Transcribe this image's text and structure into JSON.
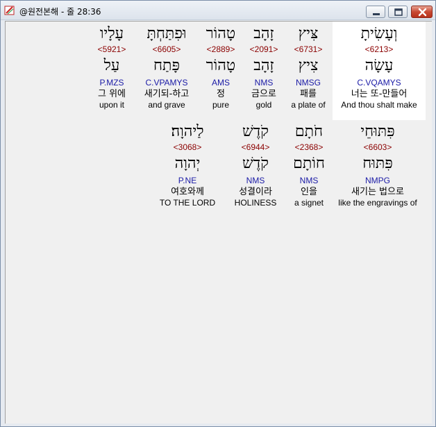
{
  "window": {
    "title": "@원전본해 - 줄 28:36",
    "icon": "bible-app-icon",
    "buttons": [
      "minimize",
      "maximize",
      "close"
    ]
  },
  "row1": [
    {
      "hebrew": "וְעָשִׂיתָ",
      "strong": "<6213>",
      "lemma": "עָשָׂה",
      "morph": "C.VQAMYS",
      "korean": "너는 또-만들어",
      "english": "And thou shalt make",
      "highlighted": true
    },
    {
      "hebrew": "צִּיץ",
      "strong": "<6731>",
      "lemma": "צִיץ",
      "morph": "NMSG",
      "korean": "패를",
      "english": "a plate of"
    },
    {
      "hebrew": "זָהָב",
      "strong": "<2091>",
      "lemma": "זָהָב",
      "morph": "NMS",
      "korean": "금으로",
      "english": "gold"
    },
    {
      "hebrew": "טָהוֹר",
      "strong": "<2889>",
      "lemma": "טָהוֹר",
      "morph": "AMS",
      "korean": "정",
      "english": "pure"
    },
    {
      "hebrew": "וּפִתַּחְתָּ",
      "strong": "<6605>",
      "lemma": "פָּתַח",
      "morph": "C.VPAMYS",
      "korean": "새기되-하고",
      "english": "and grave"
    },
    {
      "hebrew": "עָלָיו",
      "strong": "<5921>",
      "lemma": "עַל",
      "morph": "P.MZS",
      "korean": "그 위에",
      "english": "upon it"
    }
  ],
  "row2": [
    {
      "hebrew": "פִּתּוּחֵי",
      "strong": "<6603>",
      "lemma": "פִּתּוּח",
      "morph": "NMPG",
      "korean": "새기는 법으로",
      "english": "like the engravings of"
    },
    {
      "hebrew": "חֹתָם",
      "strong": "<2368>",
      "lemma": "חוֹתָם",
      "morph": "NMS",
      "korean": "인을",
      "english": "a signet"
    },
    {
      "hebrew": "קֹדֶשׁ",
      "strong": "<6944>",
      "lemma": "קֹדֶשׁ",
      "morph": "NMS",
      "korean": "성결이라",
      "english": "HOLINESS"
    },
    {
      "hebrew": "לַיהוָה׃",
      "strong": "<3068>",
      "lemma": "יְהוָה",
      "morph": "P.NE",
      "korean": "여호와께",
      "english": "TO THE LORD"
    }
  ]
}
